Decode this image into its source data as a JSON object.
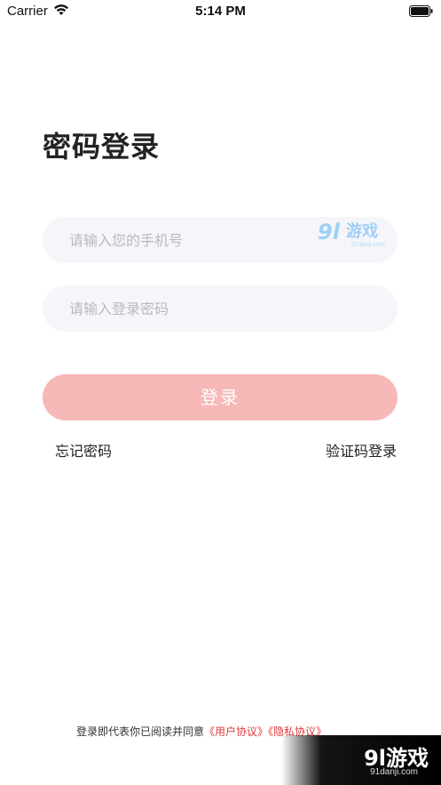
{
  "status_bar": {
    "carrier": "Carrier",
    "time": "5:14 PM",
    "wifi_icon": "wifi-icon",
    "battery_icon": "battery-icon"
  },
  "page": {
    "title": "密码登录"
  },
  "form": {
    "phone_placeholder": "请输入您的手机号",
    "password_placeholder": "请输入登录密码",
    "login_label": "登录",
    "forgot_label": "忘记密码",
    "sms_login_label": "验证码登录"
  },
  "agreement": {
    "prefix": "登录即代表你已阅读并同意",
    "user_agreement": "《用户协议》",
    "privacy_policy": "《隐私协议》"
  },
  "watermark": {
    "brand": "9l游戏",
    "domain": "91danji.com"
  },
  "colors": {
    "login_button": "#f7b8b8",
    "input_background": "#f5f5fa",
    "link_red": "#e03a3a"
  }
}
